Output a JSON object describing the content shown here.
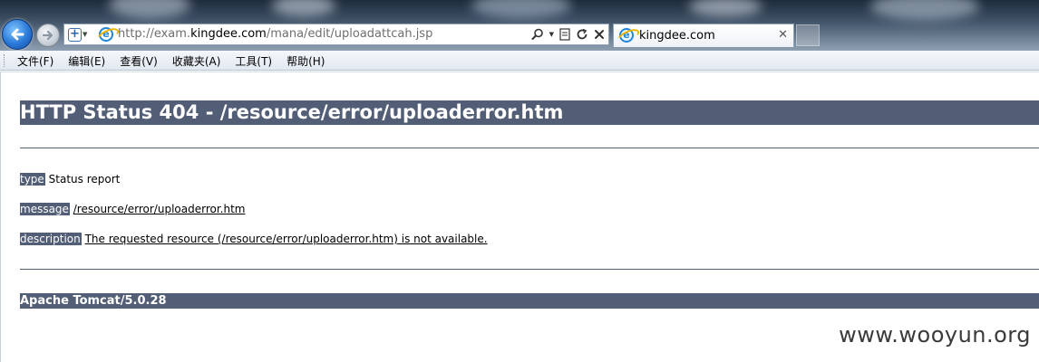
{
  "browser": {
    "address_bar": {
      "url_prefix": "http://exam.",
      "url_host": "kingdee.com",
      "url_path": "/mana/edit/uploadattcah.jsp"
    },
    "tab": {
      "title": "kingdee.com",
      "close_glyph": "✕"
    },
    "menu": [
      "文件(F)",
      "编辑(E)",
      "查看(V)",
      "收藏夹(A)",
      "工具(T)",
      "帮助(H)"
    ],
    "icons": {
      "back": "back-arrow-icon",
      "forward": "forward-arrow-icon",
      "search": "search-icon",
      "refresh": "refresh-icon",
      "stop": "stop-icon"
    }
  },
  "error_page": {
    "title": "HTTP Status 404 - /resource/error/uploaderror.htm",
    "type_label": "type",
    "type_value": "Status report",
    "message_label": "message",
    "message_value": "/resource/error/uploaderror.htm",
    "description_label": "description",
    "description_value": "The requested resource (/resource/error/uploaderror.htm) is not available.",
    "server": "Apache Tomcat/5.0.28"
  },
  "watermark": "www.wooyun.org",
  "colors": {
    "tomcat_bar": "#525d76",
    "back_button": "#2a78d6"
  }
}
